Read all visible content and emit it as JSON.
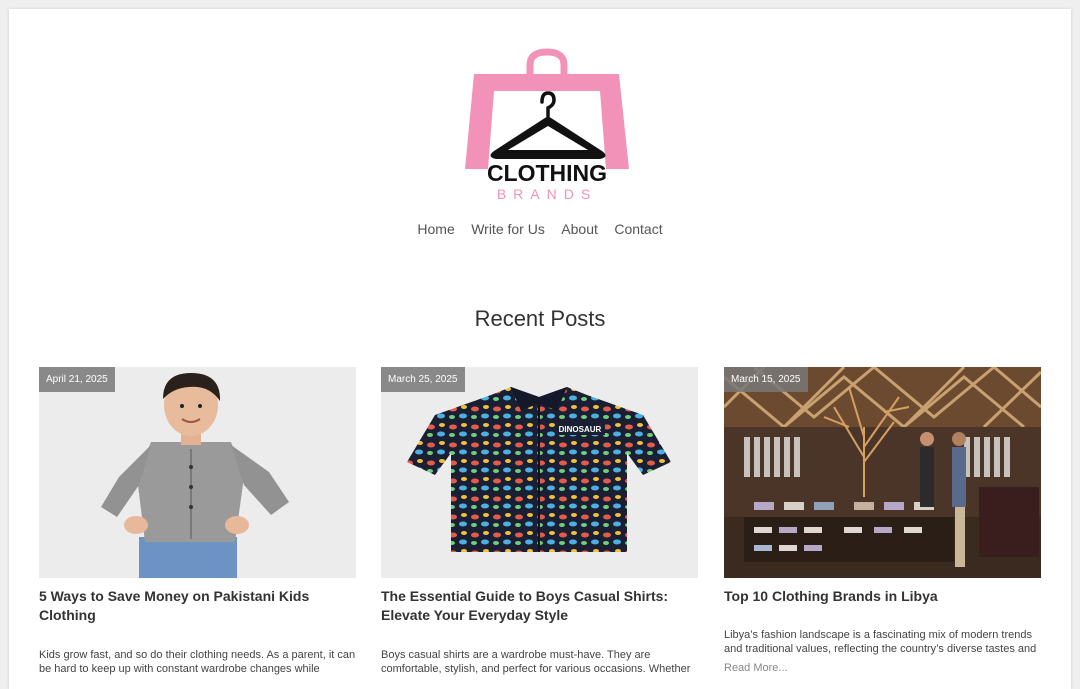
{
  "brand": {
    "line1": "CLOTHING",
    "line2": "BRANDS",
    "primary_color": "#f292b8"
  },
  "nav": {
    "items": [
      "Home",
      "Write for Us",
      "About",
      "Contact"
    ]
  },
  "section": {
    "title": "Recent Posts"
  },
  "posts": [
    {
      "date": "April 21, 2025",
      "title": "5 Ways to Save Money on Pakistani Kids Clothing",
      "excerpt": "Kids grow fast, and so do their clothing needs. As a parent, it can be hard to keep up with constant wardrobe changes while",
      "image_icon": "boy-in-gray-shirt-photo"
    },
    {
      "date": "March 25, 2025",
      "title": "The Essential Guide to Boys Casual Shirts: Elevate Your Everyday Style",
      "excerpt": "Boys casual shirts are a wardrobe must-have. They are comfortable, stylish, and perfect for various occasions. Whether",
      "image_icon": "dinosaur-print-shirt-photo",
      "shirt_label": "DINOSAUR"
    },
    {
      "date": "March 15, 2025",
      "title": "Top 10 Clothing Brands in Libya",
      "excerpt": "Libya’s fashion landscape is a fascinating mix of modern trends and traditional values, reflecting the country’s diverse tastes and",
      "read_more": "Read More...",
      "image_icon": "clothing-store-interior-photo"
    }
  ]
}
